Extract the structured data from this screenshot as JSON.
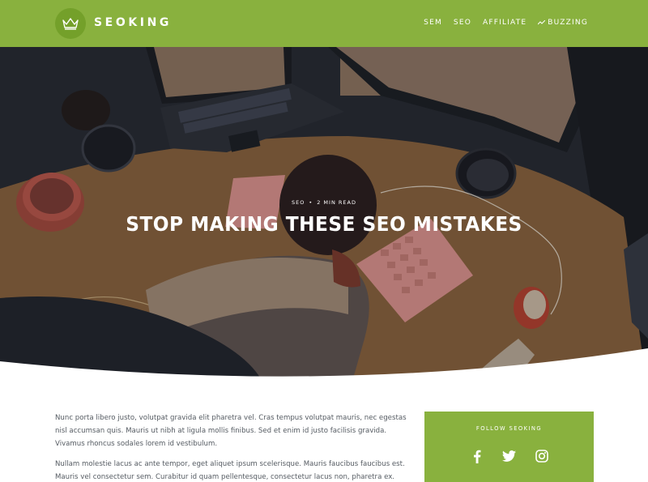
{
  "header": {
    "brand": "SEOKING",
    "nav": [
      {
        "label": "SEM"
      },
      {
        "label": "SEO"
      },
      {
        "label": "AFFILIATE"
      },
      {
        "label": "BUZZING",
        "icon": "trending-icon"
      }
    ],
    "colors": {
      "bar": "#89b13e",
      "badge": "#74a02a"
    }
  },
  "hero": {
    "category": "SEO",
    "read_time": "2 MIN READ",
    "title": "STOP MAKING THESE SEO MISTAKES"
  },
  "article": {
    "paragraphs": [
      "Nunc porta libero justo, volutpat gravida elit pharetra vel. Cras tempus volutpat mauris, nec egestas nisl accumsan quis. Mauris ut nibh at ligula mollis finibus. Sed et enim id justo facilisis gravida. Vivamus rhoncus sodales lorem id vestibulum.",
      "Nullam molestie lacus ac ante tempor, eget aliquet ipsum scelerisque. Mauris faucibus faucibus est. Mauris vel consectetur sem. Curabitur id quam pellentesque, consectetur lacus non, pharetra ex. Pellentesque vitae"
    ]
  },
  "sidebar": {
    "follow_label": "FOLLOW SEOKING",
    "social": [
      "facebook-icon",
      "twitter-icon",
      "instagram-icon"
    ]
  }
}
